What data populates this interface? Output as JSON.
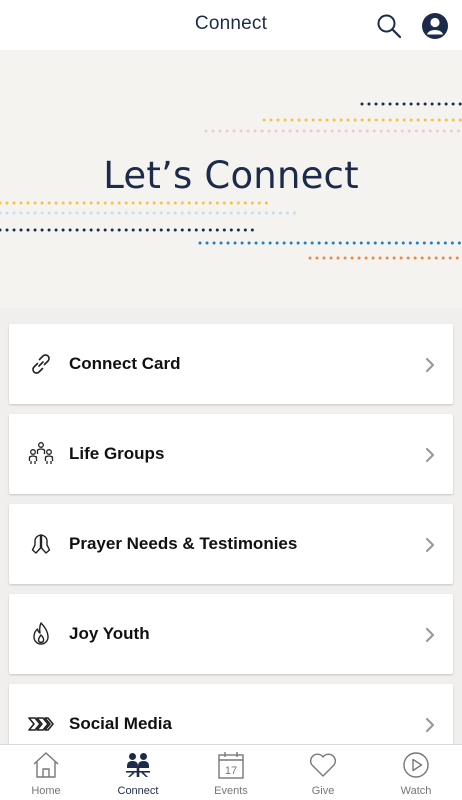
{
  "header": {
    "title": "Connect"
  },
  "hero": {
    "title": "Let’s Connect"
  },
  "colors": {
    "navy": "#1d2b4a",
    "yellow": "#f6c342",
    "pink": "#f3c8c8",
    "blue": "#1d7fc4",
    "orange": "#ef8a3a",
    "lightblue": "#c4dff2"
  },
  "menu": [
    {
      "label": "Connect Card",
      "icon": "link-icon"
    },
    {
      "label": "Life Groups",
      "icon": "people-group-icon"
    },
    {
      "label": "Prayer Needs & Testimonies",
      "icon": "praying-hands-icon"
    },
    {
      "label": "Joy Youth",
      "icon": "flame-icon"
    },
    {
      "label": "Social Media",
      "icon": "chevrons-right-icon"
    }
  ],
  "tabs": [
    {
      "label": "Home",
      "icon": "home-icon"
    },
    {
      "label": "Connect",
      "icon": "people-icon",
      "active": true
    },
    {
      "label": "Events",
      "icon": "calendar-icon",
      "date": "17"
    },
    {
      "label": "Give",
      "icon": "heart-icon"
    },
    {
      "label": "Watch",
      "icon": "play-icon"
    }
  ]
}
